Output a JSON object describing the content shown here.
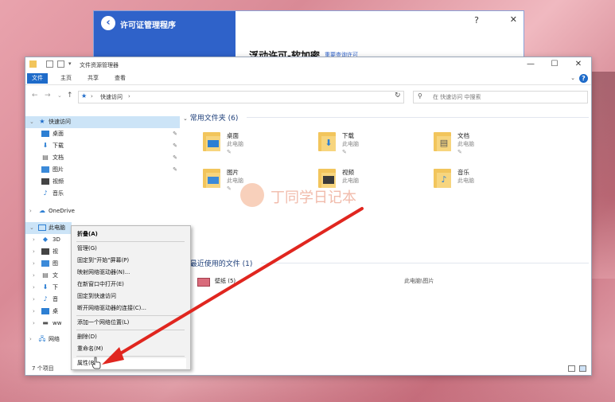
{
  "license_window": {
    "title": "许可证管理程序",
    "help": "?",
    "close": "✕",
    "heading": "浮动许可-软加密",
    "link": "重要查询许可"
  },
  "explorer": {
    "title": "文件资源管理器",
    "window_buttons": {
      "minimize": "—",
      "maximize": "☐",
      "close": "✕"
    },
    "ribbon_tabs": [
      "文件",
      "主页",
      "共享",
      "查看"
    ],
    "address": "快速访问",
    "address_sep": "›",
    "search_placeholder": "在 快速访问 中搜索",
    "nav": {
      "quick_access": "快速访问",
      "quick_items": [
        {
          "label": "桌面",
          "pinned": true
        },
        {
          "label": "下载",
          "pinned": true
        },
        {
          "label": "文档",
          "pinned": true
        },
        {
          "label": "图片",
          "pinned": true
        },
        {
          "label": "视频",
          "pinned": false
        },
        {
          "label": "音乐",
          "pinned": false
        }
      ],
      "onedrive": "OneDrive",
      "this_pc": "此电脑",
      "pc_items": [
        "3D",
        "视",
        "图",
        "文",
        "下",
        "音",
        "桌",
        "ww"
      ],
      "network": "网络"
    },
    "frequent": {
      "title": "常用文件夹 (6)",
      "folders": [
        {
          "name": "桌面",
          "sub": "此电脑"
        },
        {
          "name": "下载",
          "sub": "此电脑"
        },
        {
          "name": "文档",
          "sub": "此电脑"
        },
        {
          "name": "图片",
          "sub": "此电脑"
        },
        {
          "name": "视频",
          "sub": "此电脑"
        },
        {
          "name": "音乐",
          "sub": "此电脑"
        }
      ]
    },
    "recent": {
      "title": "最近使用的文件 (1)",
      "items": [
        {
          "name": "壁纸 (5)",
          "location": "此电脑\\图片"
        }
      ]
    },
    "status": "7 个项目"
  },
  "context_menu": {
    "items": [
      "折叠(A)",
      "管理(G)",
      "固定到\"开始\"屏幕(P)",
      "映射网络驱动器(N)...",
      "在新窗口中打开(E)",
      "固定到快速访问",
      "断开网络驱动器的连接(C)...",
      "添加一个网络位置(L)",
      "删除(D)",
      "重命名(M)",
      "属性(R)"
    ]
  },
  "watermark": "丁同学日记本",
  "colors": {
    "accent": "#1e6bc9",
    "license_blue": "#2f62c9",
    "arrow": "#e0261f"
  }
}
